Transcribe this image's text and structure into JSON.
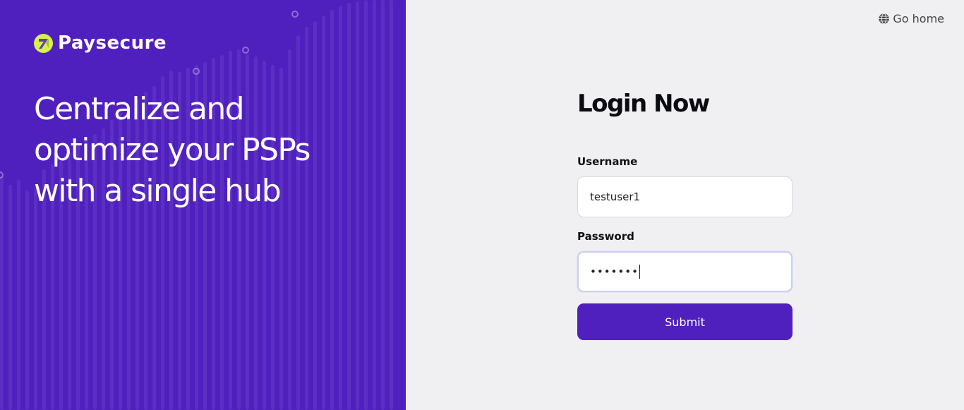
{
  "brand": {
    "name": "Paysecure",
    "logo_icon": "paysecure-logo-icon",
    "logo_color": "#d4f24a"
  },
  "hero": {
    "headline_lines": [
      "Centralize and",
      "optimize your PSPs",
      "with a single hub"
    ]
  },
  "nav": {
    "go_home_label": "Go home",
    "go_home_icon": "globe-icon"
  },
  "login": {
    "title": "Login Now",
    "username_label": "Username",
    "username_value": "testuser1",
    "password_label": "Password",
    "password_value": "•••••••",
    "submit_label": "Submit"
  },
  "colors": {
    "accent": "#5020bf",
    "page_background": "#f0f0f2"
  }
}
